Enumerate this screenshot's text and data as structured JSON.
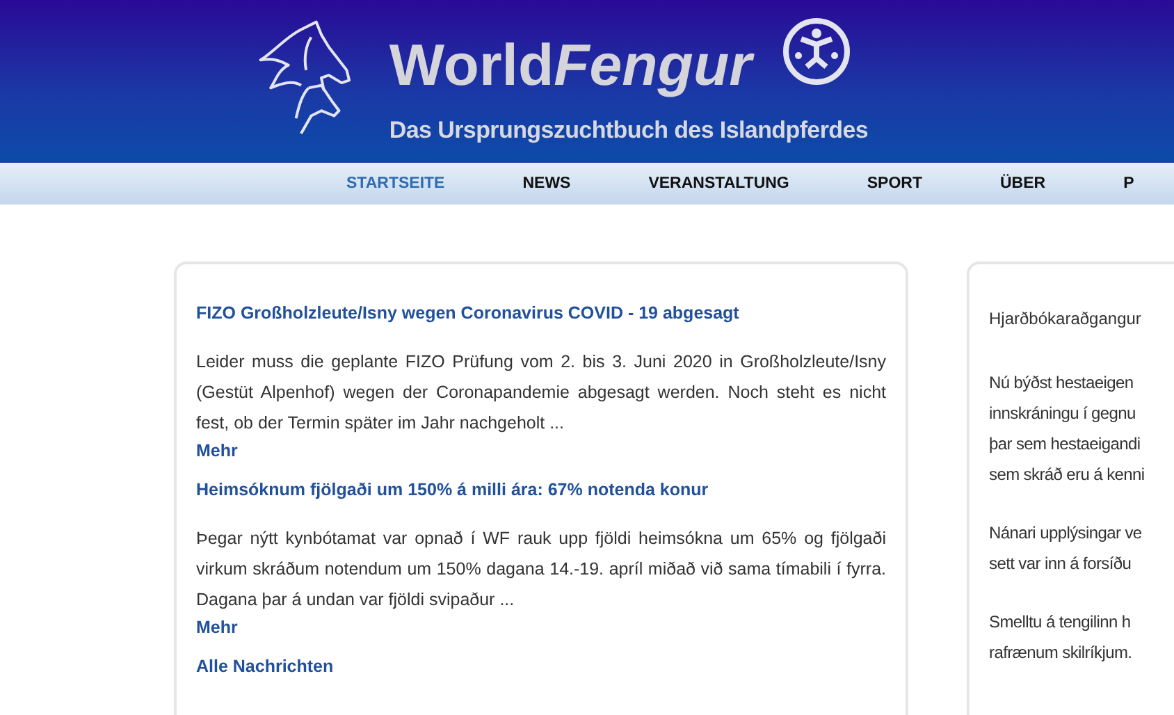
{
  "header": {
    "logo_title": {
      "plain": "World",
      "italic": "Fengur"
    },
    "subtitle": "Das Ursprungszuchtbuch des Islandpferdes"
  },
  "nav": [
    {
      "label": "STARTSEITE",
      "selected": true
    },
    {
      "label": "NEWS",
      "selected": false
    },
    {
      "label": "VERANSTALTUNG",
      "selected": false
    },
    {
      "label": "SPORT",
      "selected": false
    },
    {
      "label": "ÜBER",
      "selected": false
    },
    {
      "label": "P",
      "selected": false
    }
  ],
  "news": [
    {
      "title": "FIZO Großholzleute/Isny wegen Coronavirus COVID - 19 abgesagt",
      "text": "Leider muss die geplante FIZO Prüfung vom 2. bis 3. Juni 2020 in Großholzleute/Isny (Gestüt Alpenhof) wegen der Coronapandemie abgesagt werden. Noch steht es nicht fest, ob der Termin später im Jahr nachgeholt ...",
      "more": "Mehr"
    },
    {
      "title": "Heimsóknum fjölgaði um 150% á milli ára: 67% notenda konur",
      "text": "Þegar nýtt kynbótamat var opnað í WF rauk upp fjöldi heimsókna um 65% og fjölgaði virkum skráðum notendum um 150% dagana 14.-19. apríl miðað við sama tímabili í fyrra. Dagana þar á undan var fjöldi svipaður ...",
      "more": "Mehr"
    }
  ],
  "all_news": "Alle Nachrichten",
  "side_card": {
    "title": "Hjarðbókaraðgangur",
    "paragraphs": [
      [
        "Nú býðst hestaeigen",
        "innskráningu í gegnu",
        "þar sem hestaeigandi",
        "sem skráð eru á kenni"
      ],
      [
        "Nánari upplýsingar ve",
        "sett var inn á forsíðu"
      ],
      [
        "Smelltu á tengilinn h",
        "rafrænum skilríkjum."
      ]
    ]
  }
}
